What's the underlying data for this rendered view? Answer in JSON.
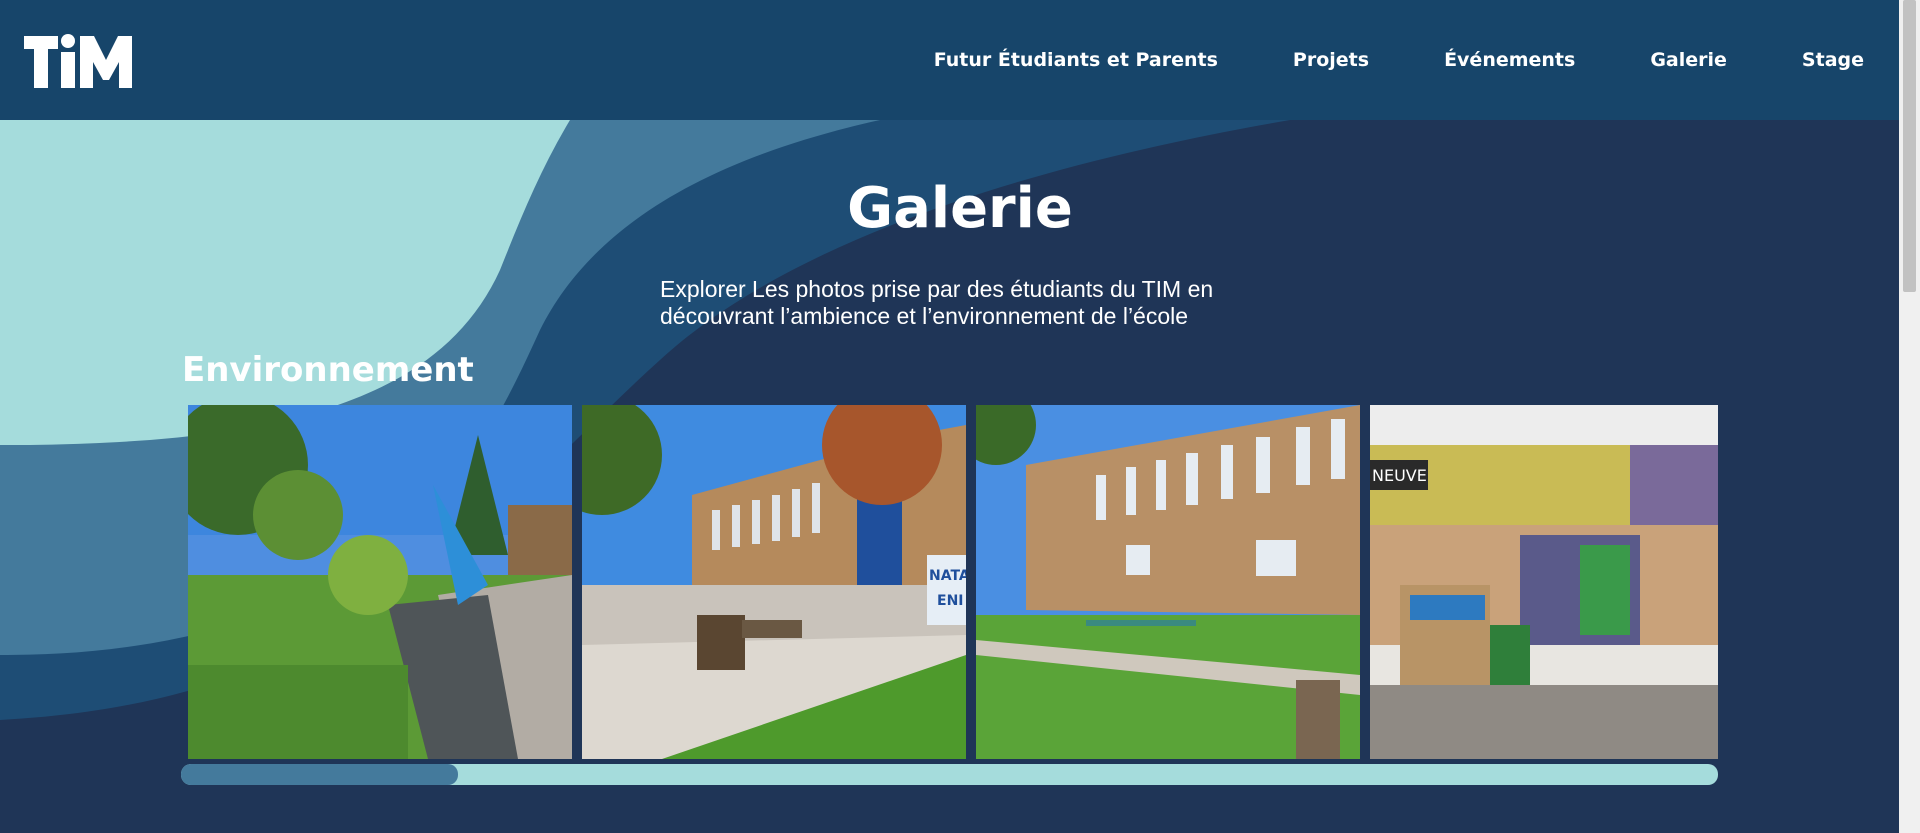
{
  "header": {
    "logo_text": "TIM",
    "nav": [
      "Futur Étudiants et Parents",
      "Projets",
      "Événements",
      "Galerie",
      "Stage"
    ]
  },
  "hero": {
    "title": "Galerie",
    "subtitle_line1": "Explorer Les photos prise par des étudiants du TIM en",
    "subtitle_line2": "découvrant l’ambience et l’environnement de l’école"
  },
  "section": {
    "title": "Environnement"
  },
  "photos": [
    {
      "name": "photo-sculpture-garden",
      "subject": "garden with blue sculpture"
    },
    {
      "name": "photo-school-courtyard",
      "subject": "school building courtyard"
    },
    {
      "name": "photo-school-facade",
      "subject": "school building facade"
    },
    {
      "name": "photo-school-store",
      "subject": "school store interior"
    }
  ],
  "photo_signs": {
    "banner_a": "NATAT",
    "banner_b": "ENI",
    "store_sign": "NEUVE"
  },
  "carousel": {
    "progress": 0.18
  },
  "colors": {
    "header_bg": "#17456a",
    "page_bg": "#1f3557",
    "wave_light": "#a5dcdc",
    "wave_mid": "#447a9c",
    "wave_dark": "#1e4d75"
  }
}
